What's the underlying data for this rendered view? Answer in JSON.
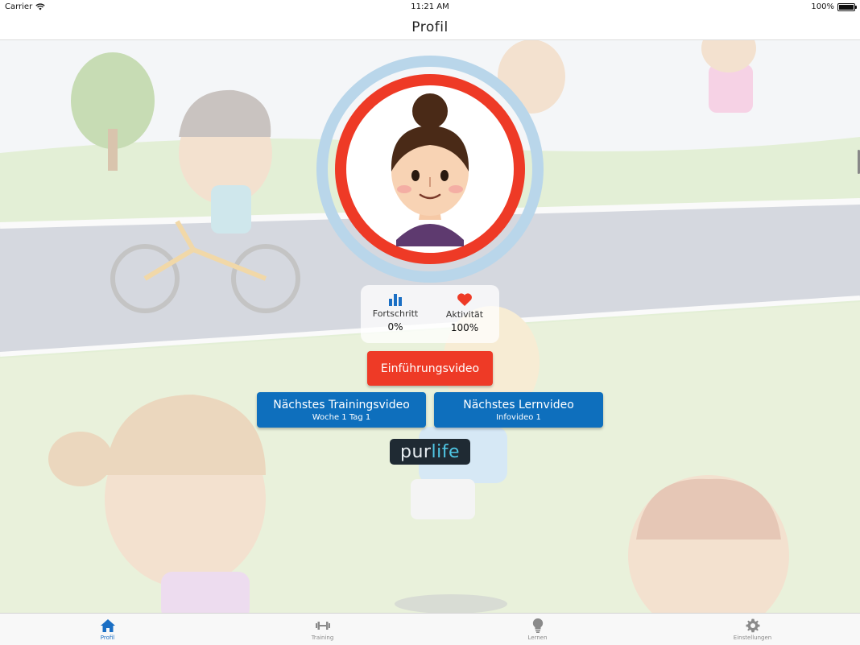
{
  "status_bar": {
    "carrier": "Carrier",
    "time": "11:21 AM",
    "battery": "100%"
  },
  "nav": {
    "title": "Profil"
  },
  "stats": [
    {
      "icon": "bar-chart-icon",
      "label": "Fortschritt",
      "value": "0%"
    },
    {
      "icon": "heart-icon",
      "label": "Aktivität",
      "value": "100%"
    }
  ],
  "buttons": {
    "intro": "Einführungsvideo",
    "training": {
      "label": "Nächstes Trainingsvideo",
      "sub": "Woche 1 Tag 1"
    },
    "learn": {
      "label": "Nächstes Lernvideo",
      "sub": "Infovideo 1"
    }
  },
  "logo": {
    "part1": "pur",
    "part2": "life"
  },
  "tabs": [
    {
      "label": "Profil",
      "icon": "home-icon",
      "active": true
    },
    {
      "label": "Training",
      "icon": "dumbbell-icon",
      "active": false
    },
    {
      "label": "Lernen",
      "icon": "lightbulb-icon",
      "active": false
    },
    {
      "label": "Einstellungen",
      "icon": "gear-icon",
      "active": false
    }
  ],
  "colors": {
    "accent_red": "#ee3a26",
    "accent_blue": "#0e6fbd",
    "tab_active": "#1b6fc4"
  }
}
